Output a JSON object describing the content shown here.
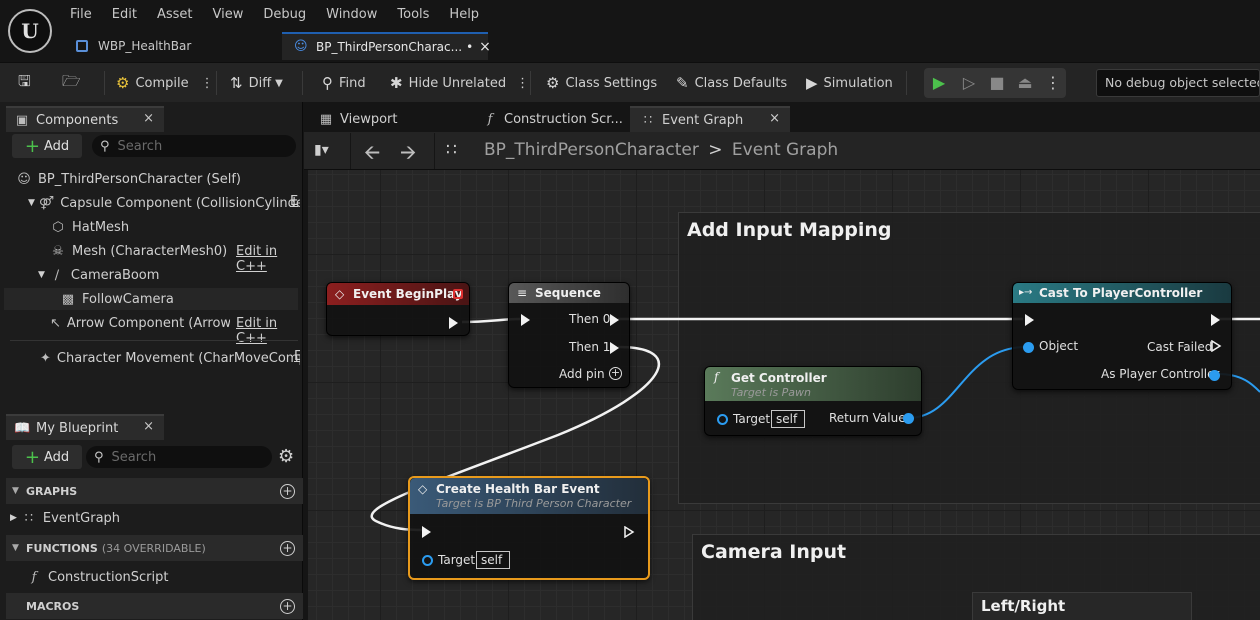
{
  "menu": [
    "File",
    "Edit",
    "Asset",
    "View",
    "Debug",
    "Window",
    "Tools",
    "Help"
  ],
  "doc_tabs": [
    {
      "label": "WBP_HealthBar"
    },
    {
      "label": "BP_ThirdPersonCharac...",
      "modified": "•",
      "close": "×"
    }
  ],
  "toolbar": {
    "compile": "Compile",
    "diff": "Diff",
    "find": "Find",
    "hide_unrelated": "Hide Unrelated",
    "class_settings": "Class Settings",
    "class_defaults": "Class Defaults",
    "simulation": "Simulation",
    "debug_select": "No debug object selected"
  },
  "components": {
    "tab": "Components",
    "add": "Add",
    "search_placeholder": "Search",
    "items": [
      {
        "label": "BP_ThirdPersonCharacter (Self)"
      },
      {
        "label": "Capsule Component (CollisionCylinder)",
        "edit": "E"
      },
      {
        "label": "HatMesh"
      },
      {
        "label": "Mesh (CharacterMesh0)",
        "edit": "Edit in C++"
      },
      {
        "label": "CameraBoom"
      },
      {
        "label": "FollowCamera"
      },
      {
        "label": "Arrow Component (Arrow)",
        "edit": "Edit in C++"
      },
      {
        "label": "Character Movement (CharMoveComp)",
        "edit": "E"
      }
    ]
  },
  "my_blueprint": {
    "tab": "My Blueprint",
    "add": "Add",
    "search_placeholder": "Search",
    "graphs": "GRAPHS",
    "event_graph": "EventGraph",
    "functions": "FUNCTIONS",
    "functions_count": "(34 OVERRIDABLE)",
    "construction_script": "ConstructionScript",
    "macros": "MACROS"
  },
  "editor_tabs": [
    "Viewport",
    "Construction Scr...",
    "Event Graph"
  ],
  "close_glyph": "×",
  "breadcrumb": {
    "root": "BP_ThirdPersonCharacter",
    "sep": ">",
    "current": "Event Graph"
  },
  "graph": {
    "comment1": "Add Input Mapping",
    "comment2": "Camera Input",
    "comment3": "Left/Right",
    "begin_play": {
      "title": "Event BeginPlay"
    },
    "sequence": {
      "title": "Sequence",
      "then0": "Then 0",
      "then1": "Then 1",
      "add_pin": "Add pin"
    },
    "get_controller": {
      "title": "Get Controller",
      "subtitle": "Target is Pawn",
      "target": "Target",
      "self": "self",
      "return": "Return Value"
    },
    "cast": {
      "title": "Cast To PlayerController",
      "object": "Object",
      "failed": "Cast Failed",
      "as_pc": "As Player Controller"
    },
    "health": {
      "title": "Create Health Bar Event",
      "subtitle": "Target is BP Third Person Character",
      "target": "Target",
      "self": "self"
    }
  },
  "colors": {
    "accent": "#1f5fb0",
    "event_header": "#7a1c1c",
    "func_header": "#4e6b4e",
    "cast_header": "#1f5f66",
    "exec_wire": "#f2f2f2",
    "object_wire": "#2b9cf0",
    "selection": "#e89a1c"
  }
}
